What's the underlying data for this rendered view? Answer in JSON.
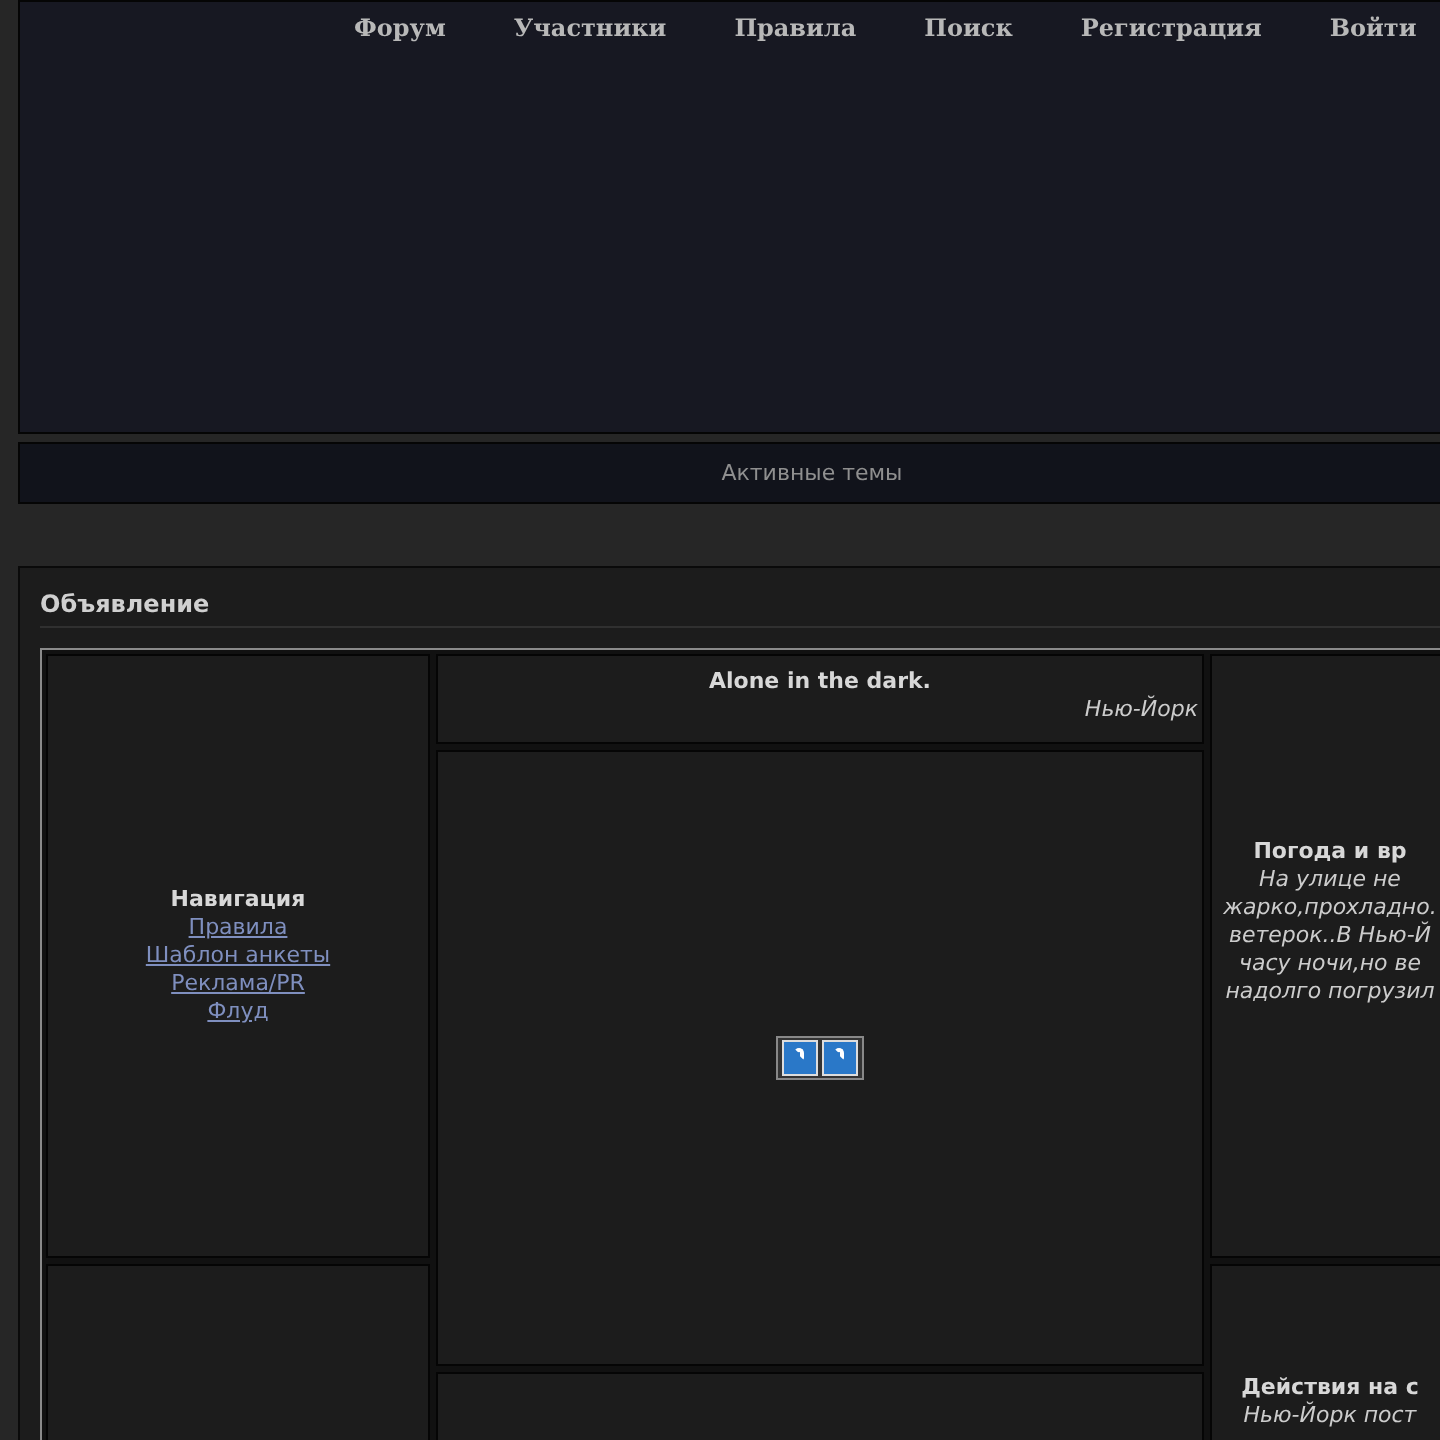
{
  "nav": [
    {
      "label": "Форум"
    },
    {
      "label": "Участники"
    },
    {
      "label": "Правила"
    },
    {
      "label": "Поиск"
    },
    {
      "label": "Регистрация"
    },
    {
      "label": "Войти"
    }
  ],
  "active_topics": "Активные темы",
  "announcement": {
    "title": "Объявление",
    "navigation": {
      "title": "Навигация",
      "links": [
        "Правила",
        "Шаблон анкеты",
        "Реклама/PR",
        "Флуд"
      ]
    },
    "header": {
      "title": "Alone in the dark.",
      "location": "Нью-Йорк"
    },
    "weather": {
      "title": "Погода и вр",
      "lines": [
        "На улице не",
        "жарко,прохладно.",
        "ветерок..В Нью-Й",
        "часу ночи,но ве",
        "надолго погрузил"
      ]
    },
    "actions": {
      "title": "Действия на с",
      "lines": [
        "Нью-Йорк пост"
      ]
    }
  }
}
